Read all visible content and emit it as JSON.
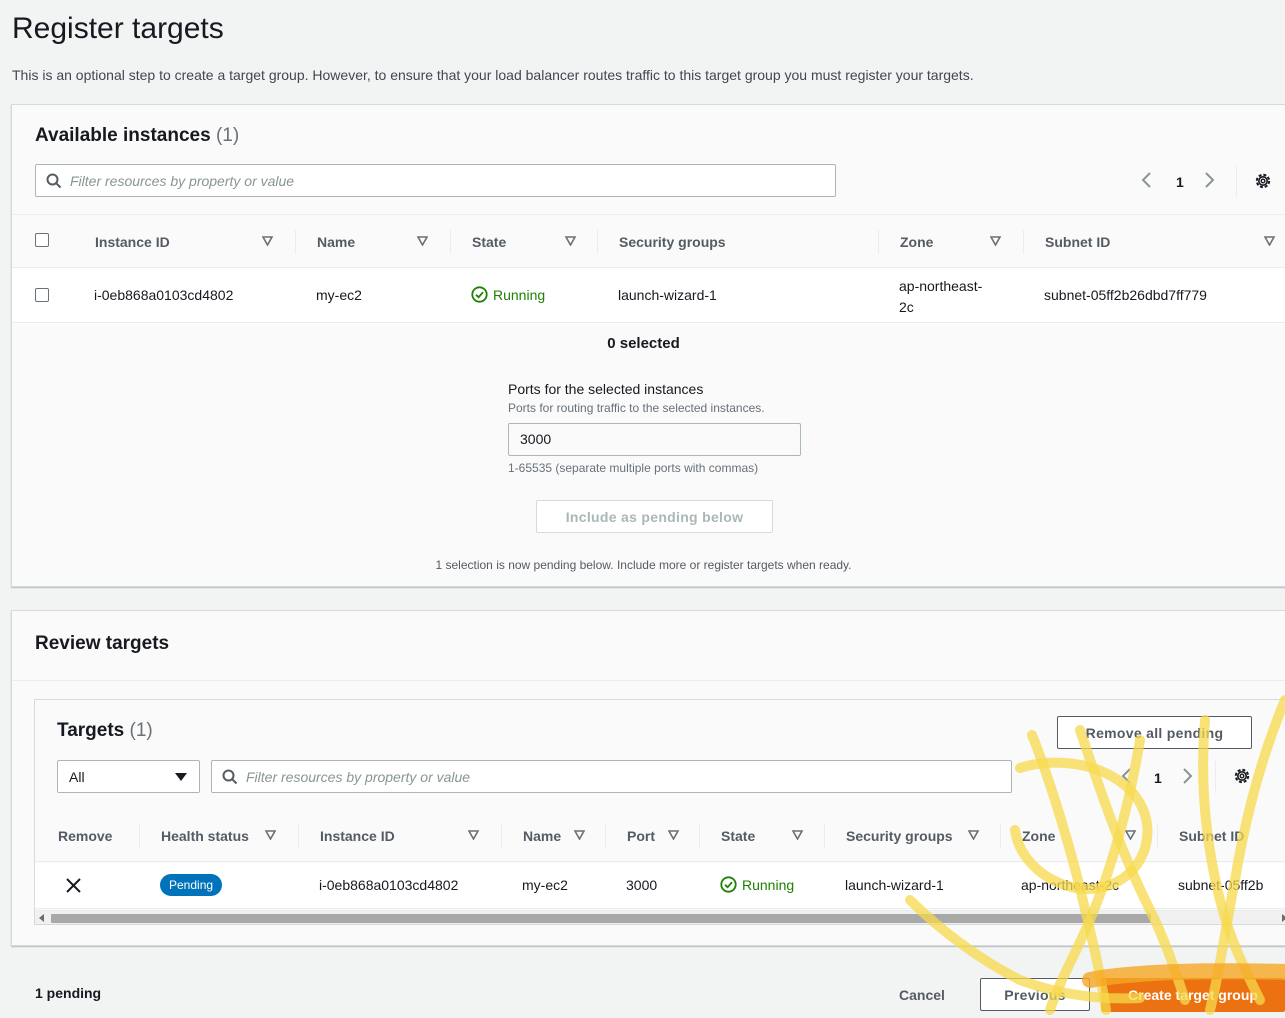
{
  "page": {
    "title": "Register targets",
    "description": "This is an optional step to create a target group. However, to ensure that your load balancer routes traffic to this target group you must register your targets."
  },
  "available": {
    "title": "Available instances",
    "count": "(1)",
    "filter_placeholder": "Filter resources by property or value",
    "page_number": "1",
    "columns": [
      "Instance ID",
      "Name",
      "State",
      "Security groups",
      "Zone",
      "Subnet ID"
    ],
    "rows": [
      {
        "instance_id": "i-0eb868a0103cd4802",
        "name": "my-ec2",
        "state": "Running",
        "security_groups": "launch-wizard-1",
        "zone_line1": "ap-northeast-",
        "zone_line2": "2c",
        "subnet_id": "subnet-05ff2b26dbd7ff779"
      }
    ],
    "selected_count": "0 selected",
    "ports_label": "Ports for the selected instances",
    "ports_description": "Ports for routing traffic to the selected instances.",
    "ports_value": "3000",
    "ports_hint": "1-65535 (separate multiple ports with commas)",
    "include_button": "Include as pending below",
    "pending_note": "1 selection is now pending below. Include more or register targets when ready."
  },
  "review": {
    "title": "Review targets",
    "targets_title": "Targets",
    "targets_count": "(1)",
    "remove_all_button": "Remove all pending",
    "filter_select": "All",
    "filter_placeholder": "Filter resources by property or value",
    "page_number": "1",
    "columns": [
      "Remove",
      "Health status",
      "Instance ID",
      "Name",
      "Port",
      "State",
      "Security groups",
      "Zone",
      "Subnet ID"
    ],
    "rows": [
      {
        "health_status": "Pending",
        "instance_id": "i-0eb868a0103cd4802",
        "name": "my-ec2",
        "port": "3000",
        "state": "Running",
        "security_groups": "launch-wizard-1",
        "zone": "ap-northeast-2c",
        "subnet_id": "subnet-05ff2b"
      }
    ]
  },
  "footer": {
    "pending": "1 pending",
    "cancel": "Cancel",
    "previous": "Previous",
    "create": "Create target group"
  },
  "colors": {
    "accent": "#ec7211",
    "running": "#1d8102",
    "pending_badge": "#0073bb",
    "annotation_scribble": "#f7d94c"
  }
}
